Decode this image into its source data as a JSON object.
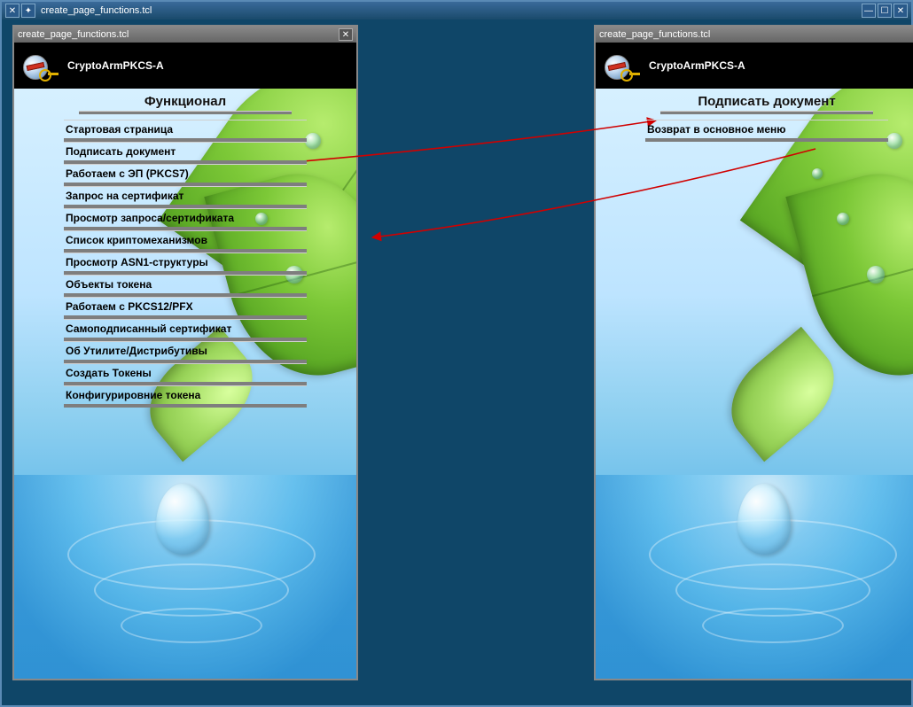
{
  "outer_window": {
    "title": "create_page_functions.tcl"
  },
  "left_window": {
    "title": "create_page_functions.tcl",
    "app_name": "CryptoArmPKCS-A",
    "page_heading": "Функционал",
    "menu": [
      "Стартовая страница",
      "Подписать документ",
      "Работаем с ЭП (PKCS7)",
      "Запрос на сертификат",
      "Просмотр запроса/сертификата",
      "Список криптомеханизмов",
      "Просмотр ASN1-структуры",
      "Объекты токена",
      "Работаем с PKCS12/PFX",
      "Самоподписанный сертификат",
      "Об Утилите/Дистрибутивы",
      "Создать Токены",
      "Конфигурировние токена"
    ]
  },
  "right_window": {
    "title": "create_page_functions.tcl",
    "app_name": "CryptoArmPKCS-A",
    "page_heading": "Подписать документ",
    "menu": [
      "Возврат в основное меню"
    ]
  }
}
